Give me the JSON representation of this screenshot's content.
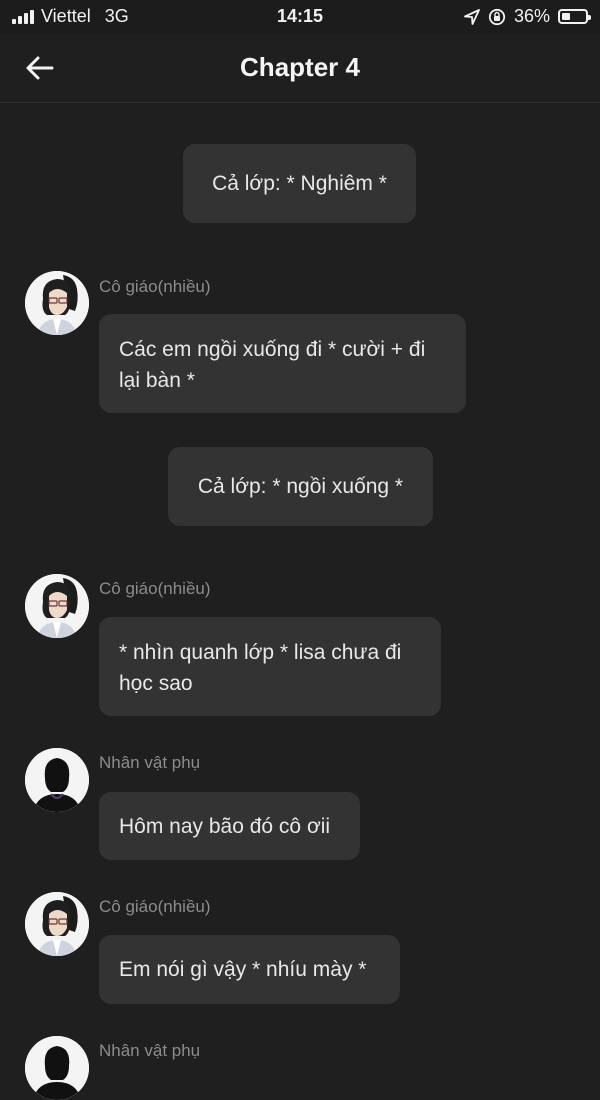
{
  "status_bar": {
    "carrier": "Viettel",
    "network": "3G",
    "time": "14:15",
    "battery_percent": "36%",
    "battery_level": 0.36,
    "signal_bars": 4,
    "icons": [
      "signal-icon",
      "location-arrow-icon",
      "orientation-lock-icon",
      "battery-icon"
    ]
  },
  "header": {
    "title": "Chapter 4",
    "back_icon": "arrow-left-icon"
  },
  "messages": [
    {
      "type": "narration",
      "text": "Cả lớp: * Nghiêm *"
    },
    {
      "type": "character",
      "speaker": "Cô giáo(nhiều)",
      "avatar": "teacher-avatar",
      "text": "Các em ngồi xuống đi * cười + đi lại bàn *"
    },
    {
      "type": "narration",
      "text": "Cả lớp: * ngồi xuống *"
    },
    {
      "type": "character",
      "speaker": "Cô giáo(nhiều)",
      "avatar": "teacher-avatar",
      "text": "* nhìn quanh lớp * lisa chưa đi học sao"
    },
    {
      "type": "character",
      "speaker": "Nhân vật phụ",
      "avatar": "silhouette-avatar",
      "text": "Hôm nay bão đó cô ơii"
    },
    {
      "type": "character",
      "speaker": "Cô giáo(nhiều)",
      "avatar": "teacher-avatar",
      "text": "Em nói gì vậy * nhíu mày *"
    },
    {
      "type": "character",
      "speaker": "Nhân vật phụ",
      "avatar": "silhouette-avatar",
      "text": ""
    }
  ],
  "colors": {
    "background": "#1f1f1f",
    "bubble": "#333333",
    "text": "#e8e8e8",
    "speaker": "#8c8c8c"
  }
}
